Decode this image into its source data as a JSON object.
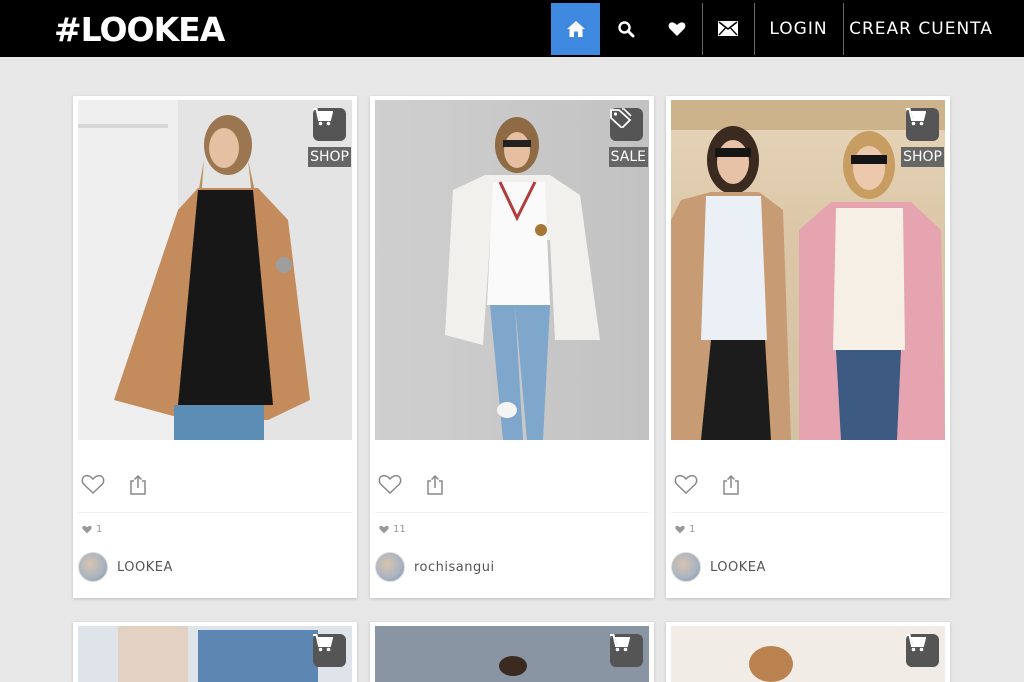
{
  "nav": {
    "logo": "#LOOKEA",
    "login": "LOGIN",
    "register": "CREAR CUENTA",
    "active_color": "#3f8ae0"
  },
  "cards": [
    {
      "badge_icon": "cart-icon",
      "badge_label": "SHOP",
      "likes": "1",
      "user": "LOOKEA"
    },
    {
      "badge_icon": "price-tag-icon",
      "badge_label": "SALE",
      "likes": "11",
      "user": "rochisangui"
    },
    {
      "badge_icon": "cart-icon",
      "badge_label": "SHOP",
      "likes": "1",
      "user": "LOOKEA"
    },
    {
      "badge_icon": "cart-icon"
    },
    {
      "badge_icon": "cart-icon"
    },
    {
      "badge_icon": "cart-icon"
    }
  ]
}
